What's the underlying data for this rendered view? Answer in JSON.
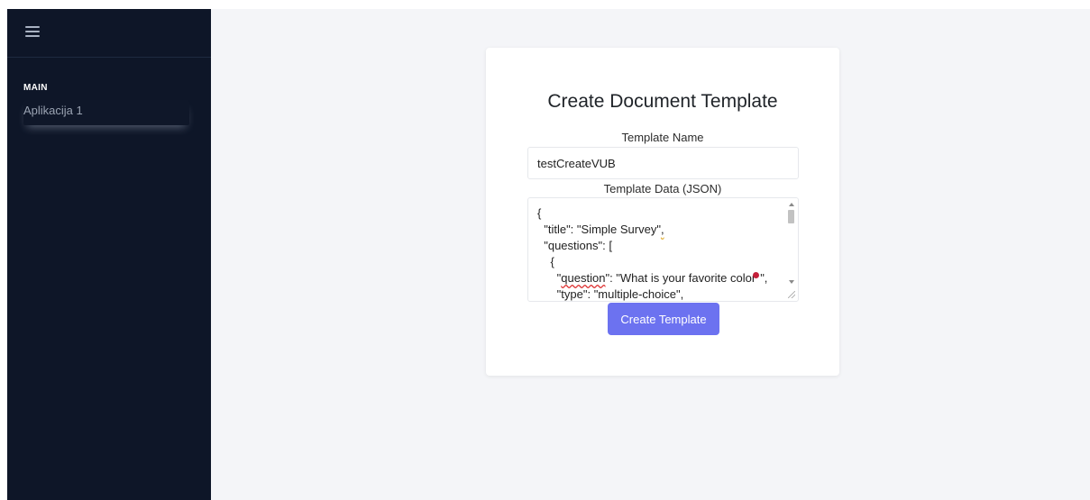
{
  "sidebar": {
    "section_label": "MAIN",
    "items": [
      {
        "label": "Aplikacija 1"
      }
    ],
    "background_color": "#0e1628"
  },
  "form": {
    "title": "Create Document Template",
    "template_name_label": "Template Name",
    "template_name_value": "testCreateVUB",
    "template_data_label": "Template Data (JSON)",
    "template_data_lines": [
      "{",
      "  \"title\": \"Simple Survey\",",
      "  \"questions\": [",
      "    {",
      "      \"question\": \"What is your favorite color?\",",
      "      \"type\": \"multiple-choice\","
    ],
    "json_line_parts": {
      "title_text": "  \"title\": \"Simple Survey\"",
      "title_comma": ",",
      "question_indent": "      \"",
      "question_key": "question",
      "question_rest_a": "\": \"What is your favorite color",
      "question_rest_b": "\","
    },
    "submit_label": "Create Template",
    "accent_color": "#6c72f0"
  }
}
